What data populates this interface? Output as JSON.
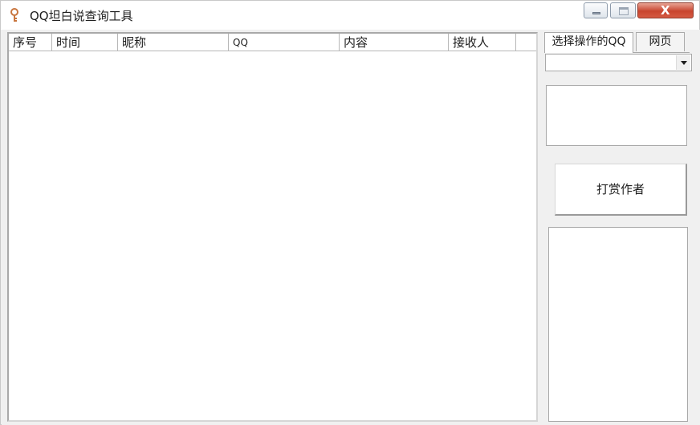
{
  "window": {
    "title": "QQ坦白说查询工具",
    "icon": "key-icon",
    "controls": {
      "minimize": "minimize-icon",
      "maximize": "maximize-icon",
      "close_glyph": "X"
    }
  },
  "list": {
    "columns": [
      {
        "label": "序号"
      },
      {
        "label": "时间"
      },
      {
        "label": "昵称"
      },
      {
        "label": "QQ"
      },
      {
        "label": "内容"
      },
      {
        "label": "接收人"
      }
    ],
    "rows": []
  },
  "side_panel": {
    "tabs": [
      {
        "label": "选择操作的QQ",
        "selected": true
      },
      {
        "label": "网页",
        "selected": false
      }
    ],
    "qq_select": {
      "value": ""
    },
    "reward_button": "打赏作者"
  }
}
